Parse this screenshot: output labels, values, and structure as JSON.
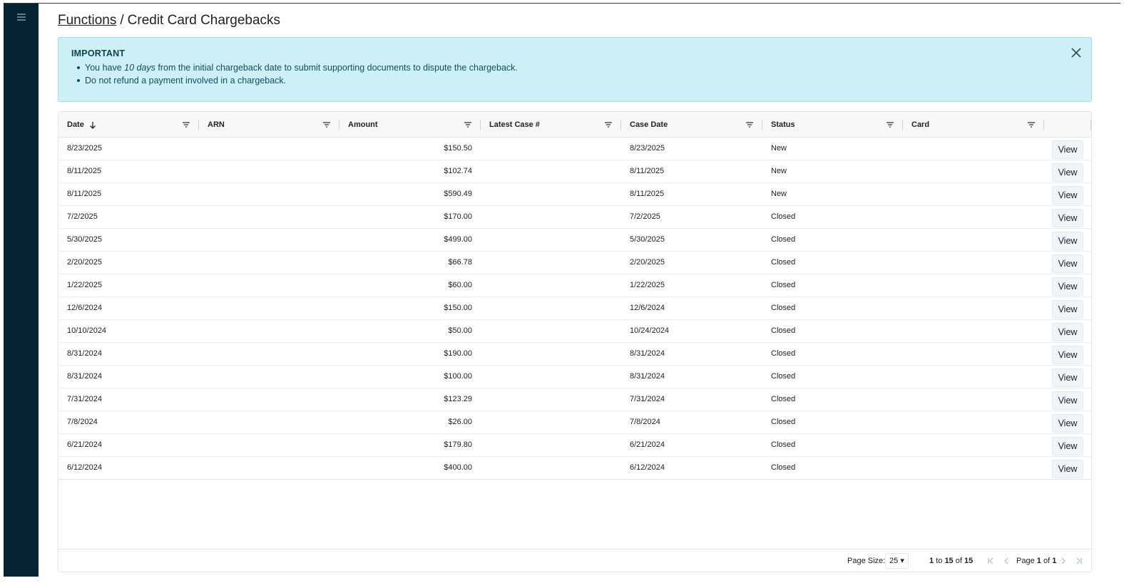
{
  "sidebar": {
    "menu_icon": "hamburger-menu-icon"
  },
  "breadcrumb": {
    "parent": "Functions",
    "separator": "/",
    "current": "Credit Card Chargebacks"
  },
  "alert": {
    "title": "IMPORTANT",
    "item1_prefix": "You have ",
    "item1_emphasis": "10 days",
    "item1_suffix": " from the initial chargeback date to submit supporting documents to dispute the chargeback.",
    "item2": "Do not refund a payment involved in a chargeback.",
    "close_icon": "close-icon",
    "background_color": "#cdf0f7"
  },
  "table": {
    "columns": [
      "Date",
      "ARN",
      "Amount",
      "Latest Case #",
      "Case Date",
      "Status",
      "Card"
    ],
    "sort_column": "Date",
    "sort_direction": "descending",
    "view_label": "View",
    "rows": [
      {
        "date": "8/23/2025",
        "arn": "",
        "amount": "$150.50",
        "latest_case": "",
        "case_date": "8/23/2025",
        "status": "New",
        "card": ""
      },
      {
        "date": "8/11/2025",
        "arn": "",
        "amount": "$102.74",
        "latest_case": "",
        "case_date": "8/11/2025",
        "status": "New",
        "card": ""
      },
      {
        "date": "8/11/2025",
        "arn": "",
        "amount": "$590.49",
        "latest_case": "",
        "case_date": "8/11/2025",
        "status": "New",
        "card": ""
      },
      {
        "date": "7/2/2025",
        "arn": "",
        "amount": "$170.00",
        "latest_case": "",
        "case_date": "7/2/2025",
        "status": "Closed",
        "card": ""
      },
      {
        "date": "5/30/2025",
        "arn": "",
        "amount": "$499.00",
        "latest_case": "",
        "case_date": "5/30/2025",
        "status": "Closed",
        "card": ""
      },
      {
        "date": "2/20/2025",
        "arn": "",
        "amount": "$66.78",
        "latest_case": "",
        "case_date": "2/20/2025",
        "status": "Closed",
        "card": ""
      },
      {
        "date": "1/22/2025",
        "arn": "",
        "amount": "$60.00",
        "latest_case": "",
        "case_date": "1/22/2025",
        "status": "Closed",
        "card": ""
      },
      {
        "date": "12/6/2024",
        "arn": "",
        "amount": "$150.00",
        "latest_case": "",
        "case_date": "12/6/2024",
        "status": "Closed",
        "card": ""
      },
      {
        "date": "10/10/2024",
        "arn": "",
        "amount": "$50.00",
        "latest_case": "",
        "case_date": "10/24/2024",
        "status": "Closed",
        "card": ""
      },
      {
        "date": "8/31/2024",
        "arn": "",
        "amount": "$190.00",
        "latest_case": "",
        "case_date": "8/31/2024",
        "status": "Closed",
        "card": ""
      },
      {
        "date": "8/31/2024",
        "arn": "",
        "amount": "$100.00",
        "latest_case": "",
        "case_date": "8/31/2024",
        "status": "Closed",
        "card": ""
      },
      {
        "date": "7/31/2024",
        "arn": "",
        "amount": "$123.29",
        "latest_case": "",
        "case_date": "7/31/2024",
        "status": "Closed",
        "card": ""
      },
      {
        "date": "7/8/2024",
        "arn": "",
        "amount": "$26.00",
        "latest_case": "",
        "case_date": "7/8/2024",
        "status": "Closed",
        "card": ""
      },
      {
        "date": "6/21/2024",
        "arn": "",
        "amount": "$179.80",
        "latest_case": "",
        "case_date": "6/21/2024",
        "status": "Closed",
        "card": ""
      },
      {
        "date": "6/12/2024",
        "arn": "",
        "amount": "$400.00",
        "latest_case": "",
        "case_date": "6/12/2024",
        "status": "Closed",
        "card": ""
      }
    ]
  },
  "pagination": {
    "page_size_label": "Page Size:",
    "page_size_value": "25",
    "range_from": "1",
    "range_to_word": "to",
    "range_to": "15",
    "range_of_word": "of",
    "range_total": "15",
    "page_word": "Page",
    "page_current": "1",
    "page_of_word": "of",
    "page_total": "1"
  },
  "colors": {
    "sidebar": "#052433",
    "alert_text": "#134d5c"
  }
}
